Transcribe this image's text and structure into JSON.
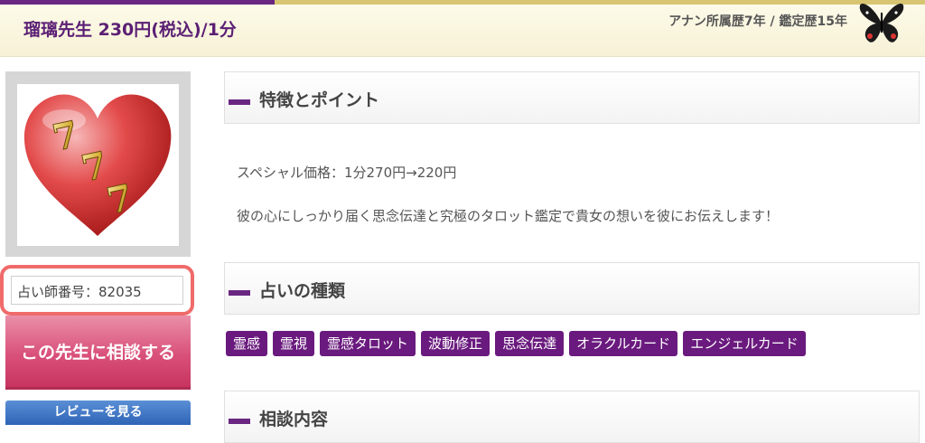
{
  "header": {
    "title": "瑠璃先生 230円(税込)/1分",
    "meta": "アナン所属歴7年 / 鑑定歴15年"
  },
  "profile": {
    "fortune_teller_id": "占い師番号：82035",
    "consult_button": "この先生に相談する",
    "review_button": "レビューを見る"
  },
  "sections": {
    "features": {
      "heading": "特徴とポイント",
      "lines": [
        "スペシャル価格：1分270円→220円",
        "彼の心にしっかり届く思念伝達と究極のタロット鑑定で貴女の想いを彼にお伝えします！"
      ]
    },
    "types": {
      "heading": "占いの種類",
      "tags": [
        "霊感",
        "霊視",
        "霊感タロット",
        "波動修正",
        "思念伝達",
        "オラクルカード",
        "エンジェルカード"
      ]
    },
    "consultation": {
      "heading": "相談内容"
    }
  },
  "icons": {
    "header_decoration": "butterfly-icon",
    "profile_image": "heart-777-image"
  },
  "colors": {
    "accent_purple": "#6a2782",
    "consult_pink": "#d9517a",
    "highlight_red": "#f06a6a",
    "review_blue": "#2f64b6"
  }
}
